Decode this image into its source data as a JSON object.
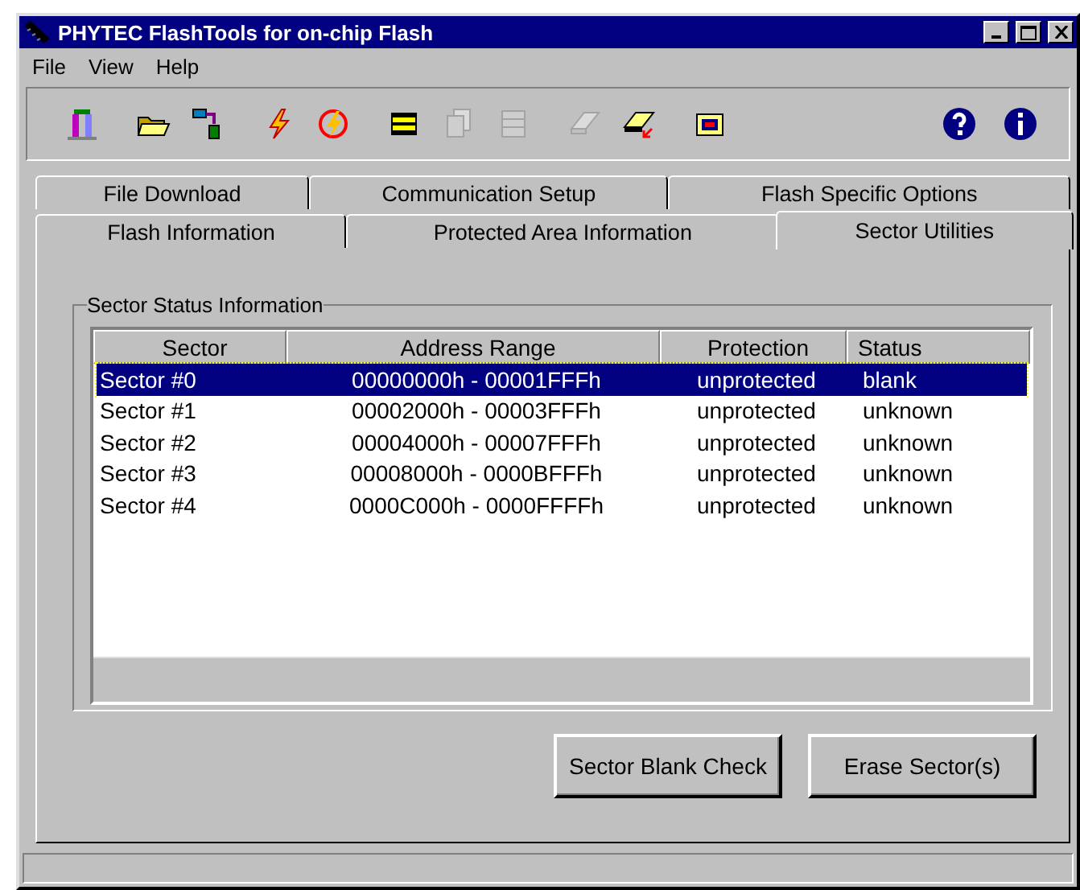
{
  "window": {
    "title": "PHYTEC FlashTools for on-chip Flash"
  },
  "menu": [
    "File",
    "View",
    "Help"
  ],
  "toolbar": [
    [
      {
        "kind": "exit",
        "disabled": false
      }
    ],
    [
      {
        "kind": "open",
        "disabled": false
      },
      {
        "kind": "download",
        "disabled": false
      }
    ],
    [
      {
        "kind": "flash",
        "disabled": false
      },
      {
        "kind": "erase",
        "disabled": false
      }
    ],
    [
      {
        "kind": "chip",
        "disabled": false
      },
      {
        "kind": "copy",
        "disabled": true
      },
      {
        "kind": "memory",
        "disabled": true
      }
    ],
    [
      {
        "kind": "board",
        "disabled": true
      },
      {
        "kind": "board-arrow",
        "disabled": false
      }
    ],
    [
      {
        "kind": "folder",
        "disabled": false
      }
    ],
    [
      {
        "kind": "help",
        "disabled": false
      },
      {
        "kind": "info",
        "disabled": false
      }
    ]
  ],
  "tabs": [
    [
      {
        "label": "File Download",
        "selected": false
      },
      {
        "label": "Communication Setup",
        "selected": false
      },
      {
        "label": "Flash Specific Options",
        "selected": false
      }
    ],
    [
      {
        "label": "Flash Information",
        "selected": false
      },
      {
        "label": "Protected Area Information",
        "selected": false
      },
      {
        "label": "Sector Utilities",
        "selected": true
      }
    ]
  ],
  "group": {
    "title": "Sector Status Information"
  },
  "table": {
    "columns": [
      "Sector",
      "Address Range",
      "Protection",
      "Status"
    ],
    "rows": [
      {
        "cells": [
          "Sector #0",
          "00000000h - 00001FFFh",
          "unprotected",
          "blank"
        ],
        "selected": true
      },
      {
        "cells": [
          "Sector #1",
          "00002000h - 00003FFFh",
          "unprotected",
          "unknown"
        ],
        "selected": false
      },
      {
        "cells": [
          "Sector #2",
          "00004000h - 00007FFFh",
          "unprotected",
          "unknown"
        ],
        "selected": false
      },
      {
        "cells": [
          "Sector #3",
          "00008000h - 0000BFFFh",
          "unprotected",
          "unknown"
        ],
        "selected": false
      },
      {
        "cells": [
          "Sector #4",
          "0000C000h - 0000FFFFh",
          "unprotected",
          "unknown"
        ],
        "selected": false
      }
    ]
  },
  "buttons": [
    "Sector Blank Check",
    "Erase Sector(s)"
  ]
}
